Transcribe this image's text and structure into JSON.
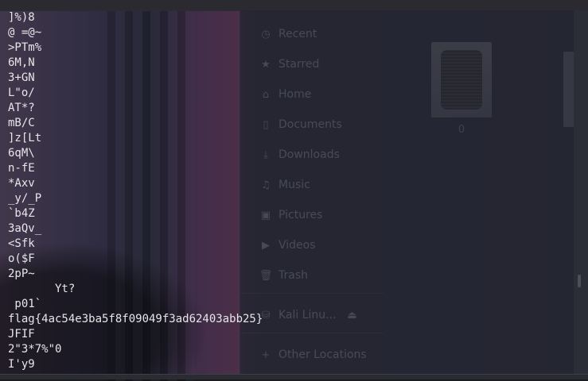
{
  "terminal": {
    "lines": [
      "]%)8",
      "@ =@~",
      ">PTm%",
      "6M,N",
      "3+GN",
      "L\"o/",
      "AT*?",
      "mB/C",
      "]z[Lt",
      "6qM\\",
      "n-fE",
      "*Axv",
      "_y/_P",
      "`b4Z",
      "3aQv_",
      "<Sfk",
      "o($F",
      "2pP~",
      "       Yt?",
      " p01`",
      "flag{4ac54e3ba5f8f09049f3ad62403abb25}",
      "JFIF",
      "2\"3*7%\"0",
      "I'y9"
    ]
  },
  "files": {
    "sidebar": [
      {
        "icon": "clock-icon",
        "label": "Recent"
      },
      {
        "icon": "star-icon",
        "label": "Starred"
      },
      {
        "icon": "home-icon",
        "label": "Home"
      },
      {
        "icon": "document-icon",
        "label": "Documents"
      },
      {
        "icon": "download-icon",
        "label": "Downloads"
      },
      {
        "icon": "music-icon",
        "label": "Music"
      },
      {
        "icon": "picture-icon",
        "label": "Pictures"
      },
      {
        "icon": "video-icon",
        "label": "Videos"
      },
      {
        "icon": "trash-icon",
        "label": "Trash"
      },
      {
        "icon": "drive-icon",
        "label": "Kali Linu..."
      },
      {
        "icon": "plus-icon",
        "label": "Other Locations"
      }
    ],
    "thumbnail_label": "0"
  }
}
